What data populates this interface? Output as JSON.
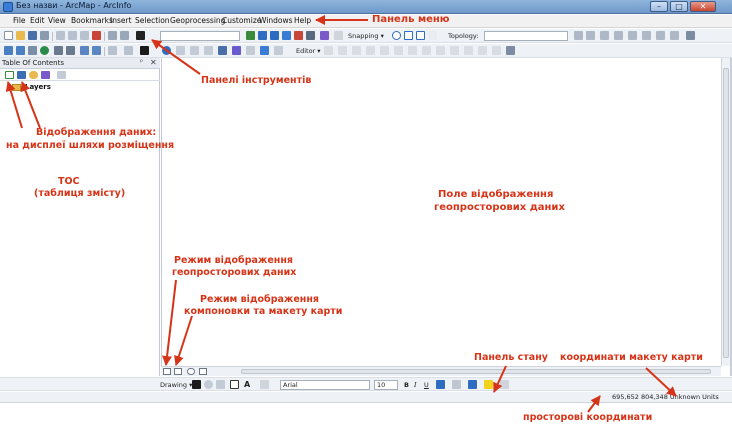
{
  "window": {
    "title": "Без назви - ArcMap - ArcInfo",
    "minimize_label": "–",
    "maximize_label": "□",
    "close_label": "✕"
  },
  "menu": {
    "items": [
      "File",
      "Edit",
      "View",
      "Bookmarks",
      "Insert",
      "Selection",
      "Geoprocessing",
      "Customize",
      "Windows",
      "Help"
    ]
  },
  "toolbar": {
    "scale_value": "",
    "snapping_label": "Snapping ▾",
    "topology_label": "Topology:",
    "editor_label": "Editor ▾"
  },
  "toc": {
    "title": "Table Of Contents",
    "pin_label": "ᵖ",
    "close_label": "✕",
    "layers_label": "Layers"
  },
  "drawbar": {
    "drawing_label": "Drawing ▾",
    "font_name": "Arial",
    "font_size": "10",
    "bold": "B",
    "italic": "I",
    "underline": "U",
    "text_tool": "A"
  },
  "status": {
    "coordinates": "695,652  804,348 Unknown Units"
  },
  "annotations": {
    "menu_panel": "Панель меню",
    "toolbars": "Панелі інструментів",
    "display_line1": "Відображення даних:",
    "display_line2": "на дисплеї   шляхи розміщення",
    "toc_line1": "TOC",
    "toc_line2": "(таблиця змісту)",
    "map_line1": "Поле відображення",
    "map_line2": "геопросторових даних",
    "data_view_line1": "Режим відображення",
    "data_view_line2": "геопросторових даних",
    "layout_view_line1": "Режим відображення",
    "layout_view_line2": "компоновки та макету карти",
    "status_panel": "Панель стану",
    "layout_coords": "координати макету карти",
    "spatial_coords": "просторові координати"
  },
  "colors": {
    "annotation": "#d63418",
    "titlebar": "#7aa3d3"
  }
}
